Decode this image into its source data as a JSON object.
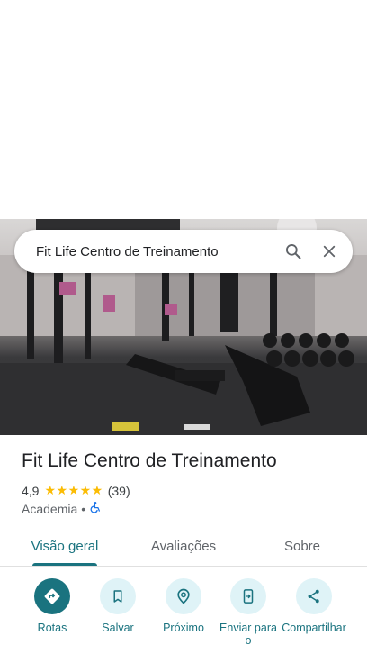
{
  "search": {
    "query": "Fit Life Centro de Treinamento"
  },
  "place": {
    "name": "Fit Life Centro de Treinamento",
    "rating": "4,9",
    "stars": "★★★★★",
    "reviews": "(39)",
    "category": "Academia",
    "separator": "•"
  },
  "tabs": [
    {
      "label": "Visão geral",
      "selected": true
    },
    {
      "label": "Avaliações",
      "selected": false
    },
    {
      "label": "Sobre",
      "selected": false
    }
  ],
  "actions": [
    {
      "label": "Rotas",
      "icon": "directions-icon"
    },
    {
      "label": "Salvar",
      "icon": "bookmark-icon"
    },
    {
      "label": "Próximo",
      "icon": "nearby-icon"
    },
    {
      "label": "Enviar para o",
      "icon": "send-to-phone-icon"
    },
    {
      "label": "Compartilhar",
      "icon": "share-icon"
    }
  ],
  "colors": {
    "accent": "#1a737f",
    "accent_light": "#dff3f7",
    "star": "#fbbc04",
    "accessibility": "#1a73e8"
  }
}
